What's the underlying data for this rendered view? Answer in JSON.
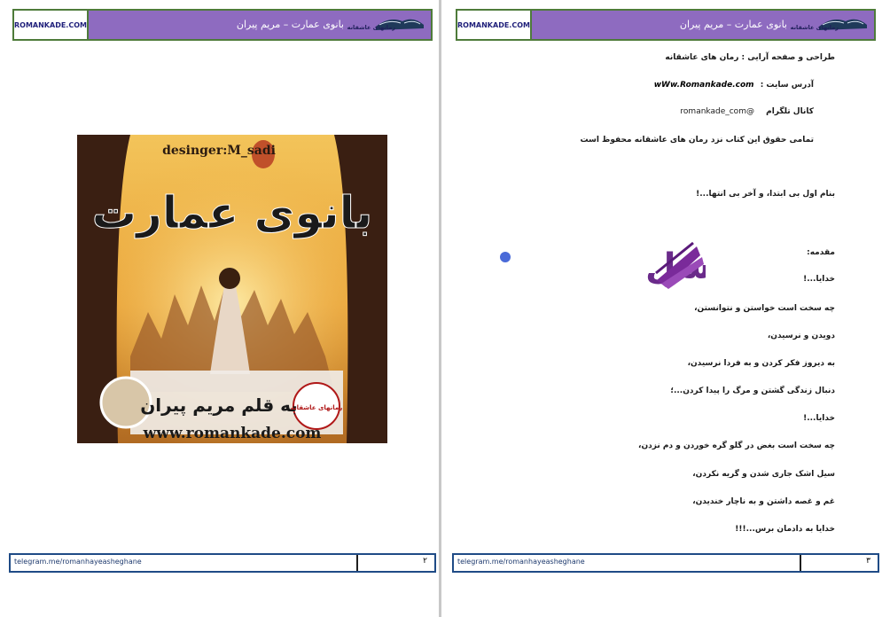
{
  "header": {
    "site": "ROMANKADE.COM",
    "title": "بانوی عمارت – مریم پیران",
    "logo_text": "رمانهای عاشقانه"
  },
  "footer": {
    "link": "telegram.me/romanhayeasheghane"
  },
  "left_page": {
    "page_number": "۲",
    "cover": {
      "designer": "desinger:M_sadi",
      "title": "بانوی عمارت",
      "author": "به قلم مریم پیران",
      "url": "www.romankade.com",
      "badge_text": "رمانهای عاشقانه"
    }
  },
  "right_page": {
    "page_number": "۳",
    "credits": {
      "design": "طراحی و صفحه آرایی : رمان های عاشقانه",
      "site_label": "آدرس سایت :",
      "site_url": "wWw.Romankade.com",
      "telegram_label": "کانال تلگرام",
      "telegram_handle": "@romankade_com",
      "rights": "تمامی حقوق این کتاب نزد رمان های عاشقانه  محفوظ است"
    },
    "opening": "بنام اول بی ابتدا،   و آخر بی انتها...!",
    "watermark": "کتاب سل",
    "intro_label": "مقدمه:",
    "lines": [
      "خدایا...!",
      "چه سخت است خواستن و نتوانستن،",
      "دویدن و نرسیدن،",
      "به دیروز فکر کردن و به فردا نرسیدن،",
      "دنبال زندگی گشتن و مرگ را پیدا کردن...؛",
      "خدایا...!",
      "چه سخت است بغض در گلو گره خوردن و دم نزدن،",
      "سیل اشک جاری شدن و گریه نکردن،",
      "غم و غصه داشتن و به ناچار خندیدن،",
      "خدایا به دادمان برس...!!!"
    ]
  }
}
